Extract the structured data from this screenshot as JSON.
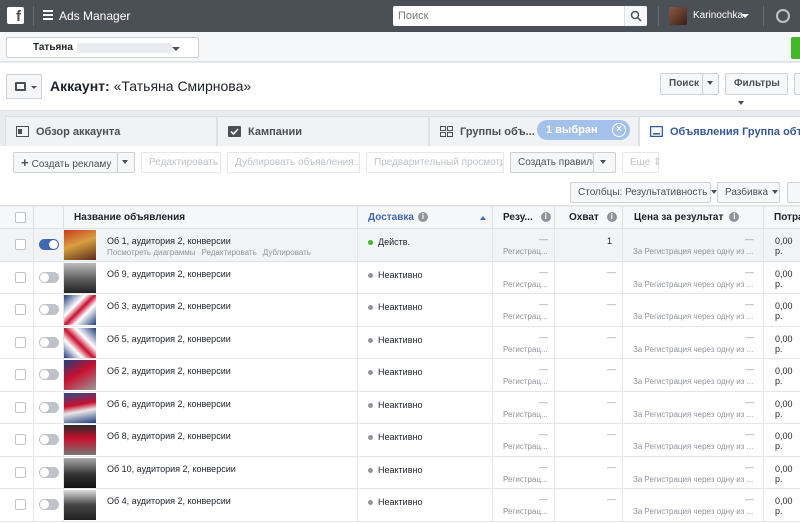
{
  "topbar": {
    "logo": "f",
    "app_title": "Ads Manager",
    "search_placeholder": "Поиск",
    "user_name": "Karinochka"
  },
  "account_selector": {
    "label": "Татьяна"
  },
  "header": {
    "title_prefix": "Аккаунт:",
    "title_name": "«Татьяна Смирнова»",
    "search_button": "Поиск",
    "filters_button": "Фильтры"
  },
  "tabs": [
    {
      "label": "Обзор аккаунта",
      "icon": "overview-icon"
    },
    {
      "label": "Кампании",
      "icon": "checkbox-icon"
    },
    {
      "label": "Группы объ...",
      "icon": "grid-icon"
    },
    {
      "label": "Объявления Группа объяв...",
      "icon": "ad-icon"
    }
  ],
  "selection_badge": "1 выбран",
  "toolbar": {
    "create_ad": "Создать рекламу",
    "edit": "Редактировать",
    "duplicate": "Дублировать объявления...",
    "preview": "Предварительный просмотр",
    "create_rule": "Создать правило",
    "more": "Еще",
    "columns": "Столбцы: Результативность",
    "breakdown": "Разбивка"
  },
  "table": {
    "columns": {
      "name": "Название объявления",
      "delivery": "Доставка",
      "results": "Резу...",
      "reach": "Охват",
      "cost": "Цена за результат",
      "spent": "Потра"
    },
    "row_links": {
      "charts": "Посмотреть диаграммы",
      "edit": "Редактировать",
      "duplicate": "Дублировать"
    },
    "rows": [
      {
        "name": "Об 1, аудитория 2, конверсии",
        "status": "Действ.",
        "active": true,
        "result": "—",
        "result_sub": "Регистрац...",
        "reach": "1",
        "cost": "—",
        "cost_sub": "За Регистрация через одну из ...",
        "spent": "0,00 р."
      },
      {
        "name": "Об 9, аудитория 2, конверсии",
        "status": "Неактивно",
        "active": false,
        "result": "—",
        "result_sub": "Регистрац...",
        "reach": "—",
        "cost": "—",
        "cost_sub": "За Регистрация через одну из ...",
        "spent": "0,00 р."
      },
      {
        "name": "Об 3, аудитория 2, конверсии",
        "status": "Неактивно",
        "active": false,
        "result": "—",
        "result_sub": "Регистрац...",
        "reach": "—",
        "cost": "—",
        "cost_sub": "За Регистрация через одну из ...",
        "spent": "0,00 р."
      },
      {
        "name": "Об 5, аудитория 2, конверсии",
        "status": "Неактивно",
        "active": false,
        "result": "—",
        "result_sub": "Регистрац...",
        "reach": "—",
        "cost": "—",
        "cost_sub": "За Регистрация через одну из ...",
        "spent": "0,00 р."
      },
      {
        "name": "Об 2, аудитория 2, конверсии",
        "status": "Неактивно",
        "active": false,
        "result": "—",
        "result_sub": "Регистрац...",
        "reach": "—",
        "cost": "—",
        "cost_sub": "За Регистрация через одну из ...",
        "spent": "0,00 р."
      },
      {
        "name": "Об 6, аудитория 2, конверсии",
        "status": "Неактивно",
        "active": false,
        "result": "—",
        "result_sub": "Регистрац...",
        "reach": "—",
        "cost": "—",
        "cost_sub": "За Регистрация через одну из ...",
        "spent": "0,00 р."
      },
      {
        "name": "Об 8, аудитория 2, конверсии",
        "status": "Неактивно",
        "active": false,
        "result": "—",
        "result_sub": "Регистрац...",
        "reach": "—",
        "cost": "—",
        "cost_sub": "За Регистрация через одну из ...",
        "spent": "0,00 р."
      },
      {
        "name": "Об 10, аудитория 2, конверсии",
        "status": "Неактивно",
        "active": false,
        "result": "—",
        "result_sub": "Регистрац...",
        "reach": "—",
        "cost": "—",
        "cost_sub": "За Регистрация через одну из ...",
        "spent": "0,00 р."
      },
      {
        "name": "Об 4, аудитория 2, конверсии",
        "status": "Неактивно",
        "active": false,
        "result": "—",
        "result_sub": "Регистрац...",
        "reach": "—",
        "cost": "—",
        "cost_sub": "За Регистрация через одну из ...",
        "spent": "0,00 р."
      }
    ]
  },
  "colors": {
    "accent": "#4267b2",
    "active_dot": "#42b72a",
    "topbar": "#4b4f56"
  }
}
